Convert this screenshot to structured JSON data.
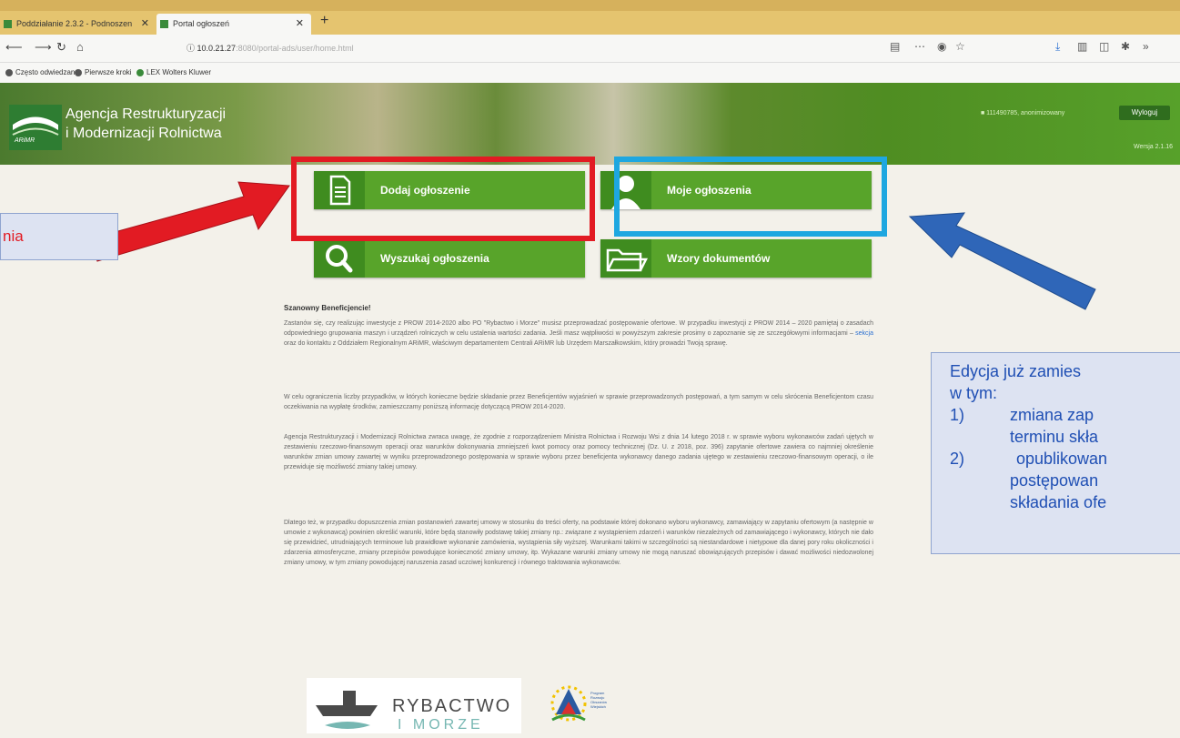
{
  "browser": {
    "tabs": [
      {
        "label": "Poddziałanie 2.3.2 - Podnoszen",
        "close": "✕"
      },
      {
        "label": "Portal ogłoszeń",
        "close": "✕"
      }
    ],
    "new_tab": "+",
    "url_host": "10.0.21.27",
    "url_path": ":8080/portal-ads/user/home.html",
    "bookmarks": [
      "Często odwiedzane",
      "Pierwsze kroki",
      "LEX Wolters Kluwer"
    ]
  },
  "header": {
    "org_line1": "Agencja Restrukturyzacji",
    "org_line2": "i Modernizacji Rolnictwa",
    "logo_text": "ARiMR",
    "user": "■ 111490785, anonimizowany",
    "logout": "Wyloguj",
    "version": "Wersja 2.1.16"
  },
  "tiles": [
    {
      "label": "Dodaj ogłoszenie",
      "icon": "document-icon"
    },
    {
      "label": "Moje ogłoszenia",
      "icon": "user-icon"
    },
    {
      "label": "Wyszukaj ogłoszenia",
      "icon": "search-icon"
    },
    {
      "label": "Wzory dokumentów",
      "icon": "folder-icon"
    }
  ],
  "content": {
    "greeting": "Szanowny Beneficjencie!",
    "p1_before": "Zastanów się, czy realizując inwestycje z PROW 2014-2020 albo PO \"Rybactwo i Morze\" musisz przeprowadzać postępowanie ofertowe. W przypadku inwestycji z PROW 2014 – 2020 pamiętaj o zasadach odpowiedniego grupowania maszyn i urządzeń rolniczych w celu ustalenia wartości zadania. Jeśli masz wątpliwości w powyższym zakresie prosimy o zapoznanie się ze szczegółowymi informacjami –",
    "p1_link": "sekcja",
    "p1_after": "oraz do kontaktu z Oddziałem Regionalnym ARiMR, właściwym departamentem Centrali ARiMR lub Urzędem Marszałkowskim, który prowadzi Twoją sprawę.",
    "p2": "W celu ograniczenia liczby przypadków, w których konieczne będzie składanie przez Beneficjentów wyjaśnień w sprawie przeprowadzonych postępowań, a tym samym w celu skrócenia Beneficjentom czasu oczekiwania na wypłatę środków, zamieszczamy poniższą informację dotyczącą PROW 2014-2020.",
    "p3": "Agencja Restrukturyzacji i Modernizacji Rolnictwa zwraca uwagę, że zgodnie z rozporządzeniem Ministra Rolnictwa i Rozwoju Wsi z dnia 14 lutego 2018 r. w sprawie wyboru wykonawców zadań ujętych w zestawieniu rzeczowo-finansowym operacji oraz warunków dokonywania zmniejszeń kwot pomocy oraz pomocy technicznej (Dz. U. z 2018, poz. 396) zapytanie ofertowe zawiera co najmniej określenie warunków zmian umowy zawartej w wyniku przeprowadzonego postępowania w sprawie wyboru przez beneficjenta wykonawcy danego zadania ujętego w zestawieniu rzeczowo-finansowym operacji, o ile przewiduje się możliwość zmiany takiej umowy.",
    "p4": "Dlatego też, w przypadku dopuszczenia zmian postanowień zawartej umowy w stosunku do treści oferty, na podstawie której dokonano wyboru wykonawcy, zamawiający w zapytaniu ofertowym (a następnie w umowie z wykonawcą) powinien określić warunki, które będą stanowiły podstawę takiej zmiany np.: związane z wystąpieniem zdarzeń i warunków niezależnych od zamawiającego i wykonawcy, których nie dało się przewidzieć, utrudniających terminowe lub prawidłowe wykonanie zamówienia, wystąpienia siły wyższej. Warunkami takimi w szczególności są niestandardowe i nietypowe dla danej pory roku okoliczności i zdarzenia atmosferyczne, zmiany przepisów powodujące konieczność zmiany umowy, itp. Wykazane warunki zmiany umowy nie mogą naruszać obowiązujących przepisów i dawać możliwości niedozwolonej zmiany umowy, w tym zmiany powodującej naruszenia zasad uczciwej konkurencji i równego traktowania wykonawców."
  },
  "footer": {
    "rybactwo": "RYBACTWO",
    "morze": "I MORZE",
    "prow_lines": [
      "Program",
      "Rozwoju",
      "Obszarów",
      "Wiejskich"
    ]
  },
  "callouts": {
    "left": "nia",
    "right_line1": "Edycja już zamies",
    "right_line2": "w tym:",
    "right_items": [
      {
        "num": "1)",
        "lines": [
          "zmiana  zap",
          "terminu skła"
        ]
      },
      {
        "num": "2)",
        "lines": [
          "opublikowan",
          "postępowan",
          "składania ofe"
        ]
      }
    ]
  },
  "colors": {
    "tile_green": "#58a42a",
    "red_highlight": "#e21b23",
    "blue_highlight": "#1ea7e0",
    "callout_text": "#1f4fb4"
  }
}
